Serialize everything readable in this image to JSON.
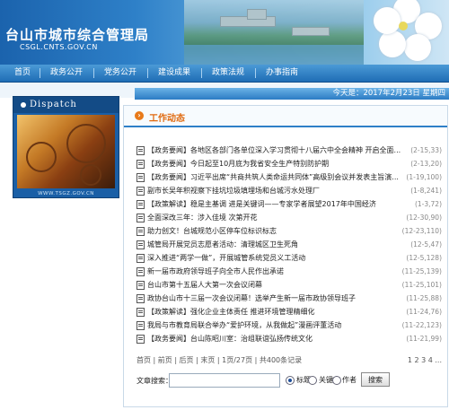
{
  "header": {
    "title": "台山市城市综合管理局",
    "domain": "CSGL.CNTS.GOV.CN"
  },
  "nav": {
    "items": [
      {
        "label": "首页"
      },
      {
        "label": "政务公开"
      },
      {
        "label": "党务公开"
      },
      {
        "label": "建设成果"
      },
      {
        "label": "政策法规"
      },
      {
        "label": "办事指南"
      }
    ]
  },
  "date_bar": {
    "text": "今天是：2017年2月23日 星期四"
  },
  "sidebar": {
    "dispatch_label": "Dispatch",
    "dispatch_url": "WWW.TSGZ.GOV.CN"
  },
  "panel": {
    "title": "工作动态",
    "items": [
      {
        "title": "【政务要闻】各地区各部门各单位深入学习贯彻十八届六中全会精神 开启全面...",
        "date": "(2-15,33)"
      },
      {
        "title": "【政务要闻】今日起至10月底为我省安全生产特别防护期",
        "date": "(2-13,20)"
      },
      {
        "title": "【政务要闻】习近平出席“共商共筑人类命运共同体”高级别会议并发表主旨演...",
        "date": "(1-19,100)"
      },
      {
        "title": "副市长吴年积视察下挂坑垃圾填埋场和台城污水处理厂",
        "date": "(1-8,241)"
      },
      {
        "title": "【政策解读】稳是主基调 进是关键词——专家学者展望2017年中国经济",
        "date": "(1-3,72)"
      },
      {
        "title": "全面深改三年：涉入佳境 次第开花",
        "date": "(12-30,90)"
      },
      {
        "title": "助力创文！台城规范小区停车位标识标志",
        "date": "(12-23,110)"
      },
      {
        "title": "城管局开展党员志愿者活动：清理城区卫生死角",
        "date": "(12-5,47)"
      },
      {
        "title": "深入推进“两学一做”，开展城管系统党员义工活动",
        "date": "(12-5,128)"
      },
      {
        "title": "新一届市政府领导班子向全市人民作出承诺",
        "date": "(11-25,139)"
      },
      {
        "title": "台山市第十五届人大第一次会议闭幕",
        "date": "(11-25,101)"
      },
      {
        "title": "政协台山市十三届一次会议闭幕！选举产生新一届市政协领导班子",
        "date": "(11-25,88)"
      },
      {
        "title": "【政策解读】强化企业主体责任 推进环境管理精细化",
        "date": "(11-24,76)"
      },
      {
        "title": "我局与市教育局联合举办“爱护环境，从我做起”漫画评董活动",
        "date": "(11-22,123)"
      },
      {
        "title": "【政务要闻】台山陈昭川室：治组联谊弘扬传统文化",
        "date": "(11-21,99)"
      }
    ]
  },
  "pager": {
    "text": "首页 | 前页 | 后页 | 末页 | 1页/27页 | 共400条记录",
    "pages": "1 2 3 4 ..."
  },
  "search": {
    "label": "文章搜索：",
    "input_value": "",
    "options": [
      {
        "label": "标题",
        "selected": true
      },
      {
        "label": "关键字",
        "selected": false
      },
      {
        "label": "作者",
        "selected": false
      }
    ],
    "button_label": "搜索"
  },
  "colors": {
    "brand_blue": "#2e80c8",
    "accent_orange": "#e06a10"
  }
}
